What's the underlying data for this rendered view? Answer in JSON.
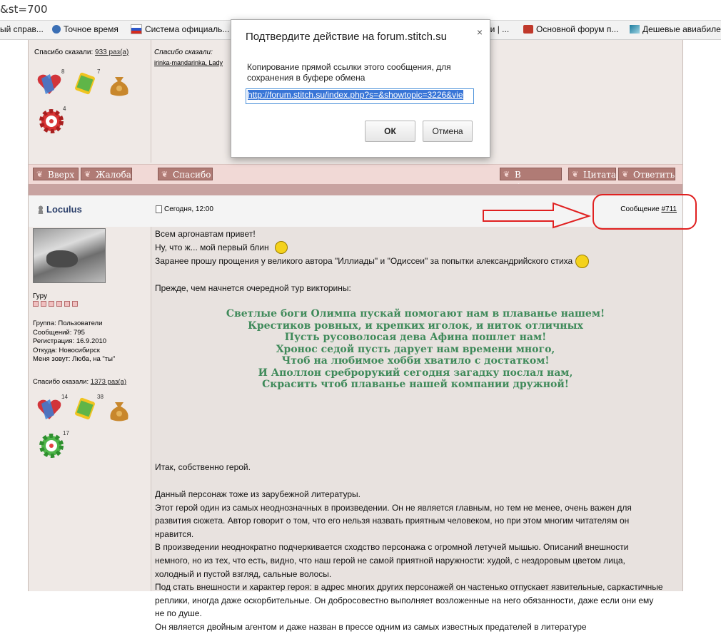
{
  "url_fragment": "&st=700",
  "bookmarks": [
    {
      "label": "ый справ..."
    },
    {
      "label": "Точное время"
    },
    {
      "label": "Система официаль..."
    },
    {
      "label": "али | ..."
    },
    {
      "label": "Основной форум п..."
    },
    {
      "label": "Дешевые авиабиле"
    }
  ],
  "prev_post": {
    "thanks_label": "Спасибо сказали:",
    "thanks_count": "933 раз(а)",
    "thanked_by_label": "Спасибо сказали:",
    "thanked_by": "irinka-mandarinka, Lady",
    "badges": [
      "8",
      "7",
      "",
      "4"
    ]
  },
  "toolbar": {
    "up": "Вверх",
    "complaint": "Жалоба",
    "thanks": "Спасибо",
    "notebook": "В блокнот",
    "quote": "Цитата",
    "reply": "Ответить"
  },
  "post": {
    "author": "Loculus",
    "date": "Сегодня, 12:00",
    "msg_label": "Сообщение",
    "msg_no": "#711",
    "rank": "Гуру",
    "info": [
      "Группа: Пользователи",
      "Сообщений: 795",
      "Регистрация: 16.9.2010",
      "Откуда: Новосибирск",
      "Меня зовут: Люба, на \"ты\""
    ],
    "thanks_label": "Спасибо сказали:",
    "thanks_count": "1373 раз(а)",
    "badges": [
      "14",
      "38",
      "",
      "17"
    ],
    "lines": [
      "Всем аргонавтам привет!",
      "Ну, что ж... мой первый блин",
      "Заранее прошу прощения у великого автора \"Иллиады\" и \"Одиссеи\" за попытки александрийского стиха",
      "Прежде, чем начнется очередной тур викторины:"
    ],
    "poem": [
      "Светлые боги Олимпа пускай помогают нам в плаванье нашем!",
      "Крестиков ровных, и крепких иголок, и ниток отличных",
      "Пусть русоволосая дева Афина пошлет нам!",
      "Хронос седой пусть дарует нам времени много,",
      "Чтоб на любимое хобби хватило с достатком!",
      "И Аполлон среброрукий сегодня загадку послал нам,",
      "Скрасить чтоб плаванье нашей компании дружной!"
    ],
    "para1": "Итак, собственно герой.",
    "para2": [
      "Данный персонаж тоже из зарубежной литературы.",
      "Этот герой один из самых неоднозначных в произведении. Он не является главным, но тем не менее, очень важен для",
      "развития сюжета. Автор говорит о том, что его нельзя назвать приятным человеком, но при этом многим читателям он",
      "нравится.",
      "В произведении неоднократно подчеркивается сходство персонажа с огромной летучей мышью. Описаний внешности",
      "немного, но из тех, что есть, видно, что наш герой не самой приятной наружности: худой, с нездоровым цветом лица,",
      "холодный и пустой взгляд, сальные волосы.",
      "Под стать внешности и характер героя: в адрес многих других персонажей он частенько отпускает язвительные, саркастичные",
      "реплики, иногда даже оскорбительные. Он добросовестно выполняет возложенные на него обязанности, даже если они ему",
      "не по душе.",
      "Он является двойным агентом и даже назван в прессе одним из самых известных предателей в литературе"
    ]
  },
  "dialog": {
    "title": "Подтвердите действие на forum.stitch.su",
    "close": "×",
    "message": "Копирование прямой ссылки этого сообщения, для сохранения в буфере обмена",
    "url": "http://forum.stitch.su/index.php?s=&showtopic=3226&vie",
    "ok": "ОК",
    "cancel": "Отмена"
  }
}
